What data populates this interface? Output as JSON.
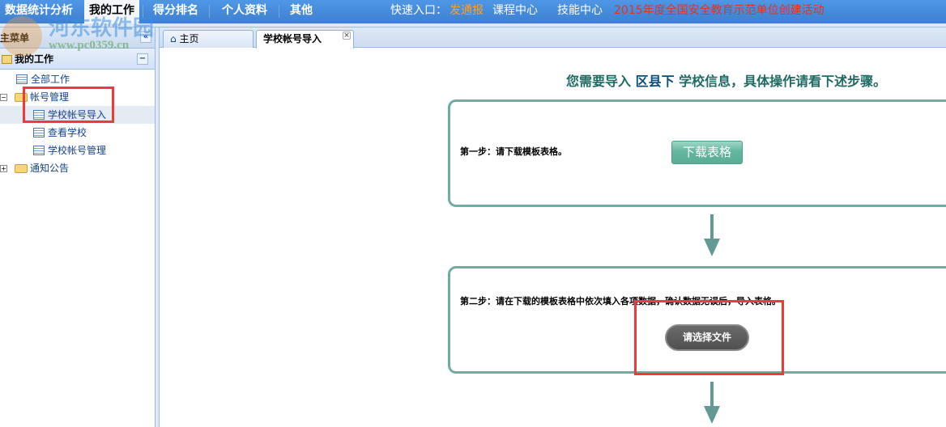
{
  "topnav": {
    "items": [
      "数据统计分析",
      "我的工作",
      "得分排名",
      "个人资料",
      "其他"
    ],
    "active": "我的工作",
    "quick_label": "快速入口：",
    "quick_links": [
      "发通报",
      "课程中心",
      "技能中心"
    ],
    "notice": "2015年度全国安全教育示范单位创建活动"
  },
  "watermark": {
    "name": "河东软件园",
    "url": "www.pc0359.cn"
  },
  "sidebar": {
    "title": "主菜单",
    "section": "我的工作",
    "tree": [
      {
        "label": "全部工作"
      },
      {
        "label": "帐号管理"
      },
      {
        "label": "学校帐号导入"
      },
      {
        "label": "查看学校"
      },
      {
        "label": "学校帐号管理"
      },
      {
        "label": "通知公告"
      }
    ]
  },
  "tabs": [
    {
      "label": "主页"
    },
    {
      "label": "学校帐号导入"
    }
  ],
  "main": {
    "headline_pre": "您需要导入 ",
    "headline_bold": "区县下",
    "headline_post": " 学校信息，具体操作请看下述步骤。",
    "step1": "第一步：请下载模板表格。",
    "download_button": "下载表格",
    "step2": "第二步：请在下载的模板表格中依次填入各项数据，确认数据无误后，导入表格。",
    "choose_file_button": "请选择文件"
  },
  "colors": {
    "accent": "#6eaea2",
    "nav": "#3e7fd0",
    "highlight": "#f03a3a",
    "quick": "#ffa020",
    "notice": "#e8301f"
  }
}
